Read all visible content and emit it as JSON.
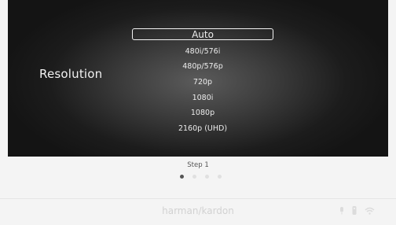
{
  "screen": {
    "setting_label": "Resolution",
    "options": [
      {
        "label": "Auto",
        "selected": true
      },
      {
        "label": "480i/576i",
        "selected": false
      },
      {
        "label": "480p/576p",
        "selected": false
      },
      {
        "label": "720p",
        "selected": false
      },
      {
        "label": "1080i",
        "selected": false
      },
      {
        "label": "1080p",
        "selected": false
      },
      {
        "label": "2160p (UHD)",
        "selected": false
      }
    ]
  },
  "wizard": {
    "step_label": "Step 1",
    "total_steps": 4,
    "current_step": 1
  },
  "footer": {
    "brand": "harman/kardon",
    "icons": [
      "microphone-icon",
      "remote-icon",
      "wifi-icon"
    ]
  }
}
